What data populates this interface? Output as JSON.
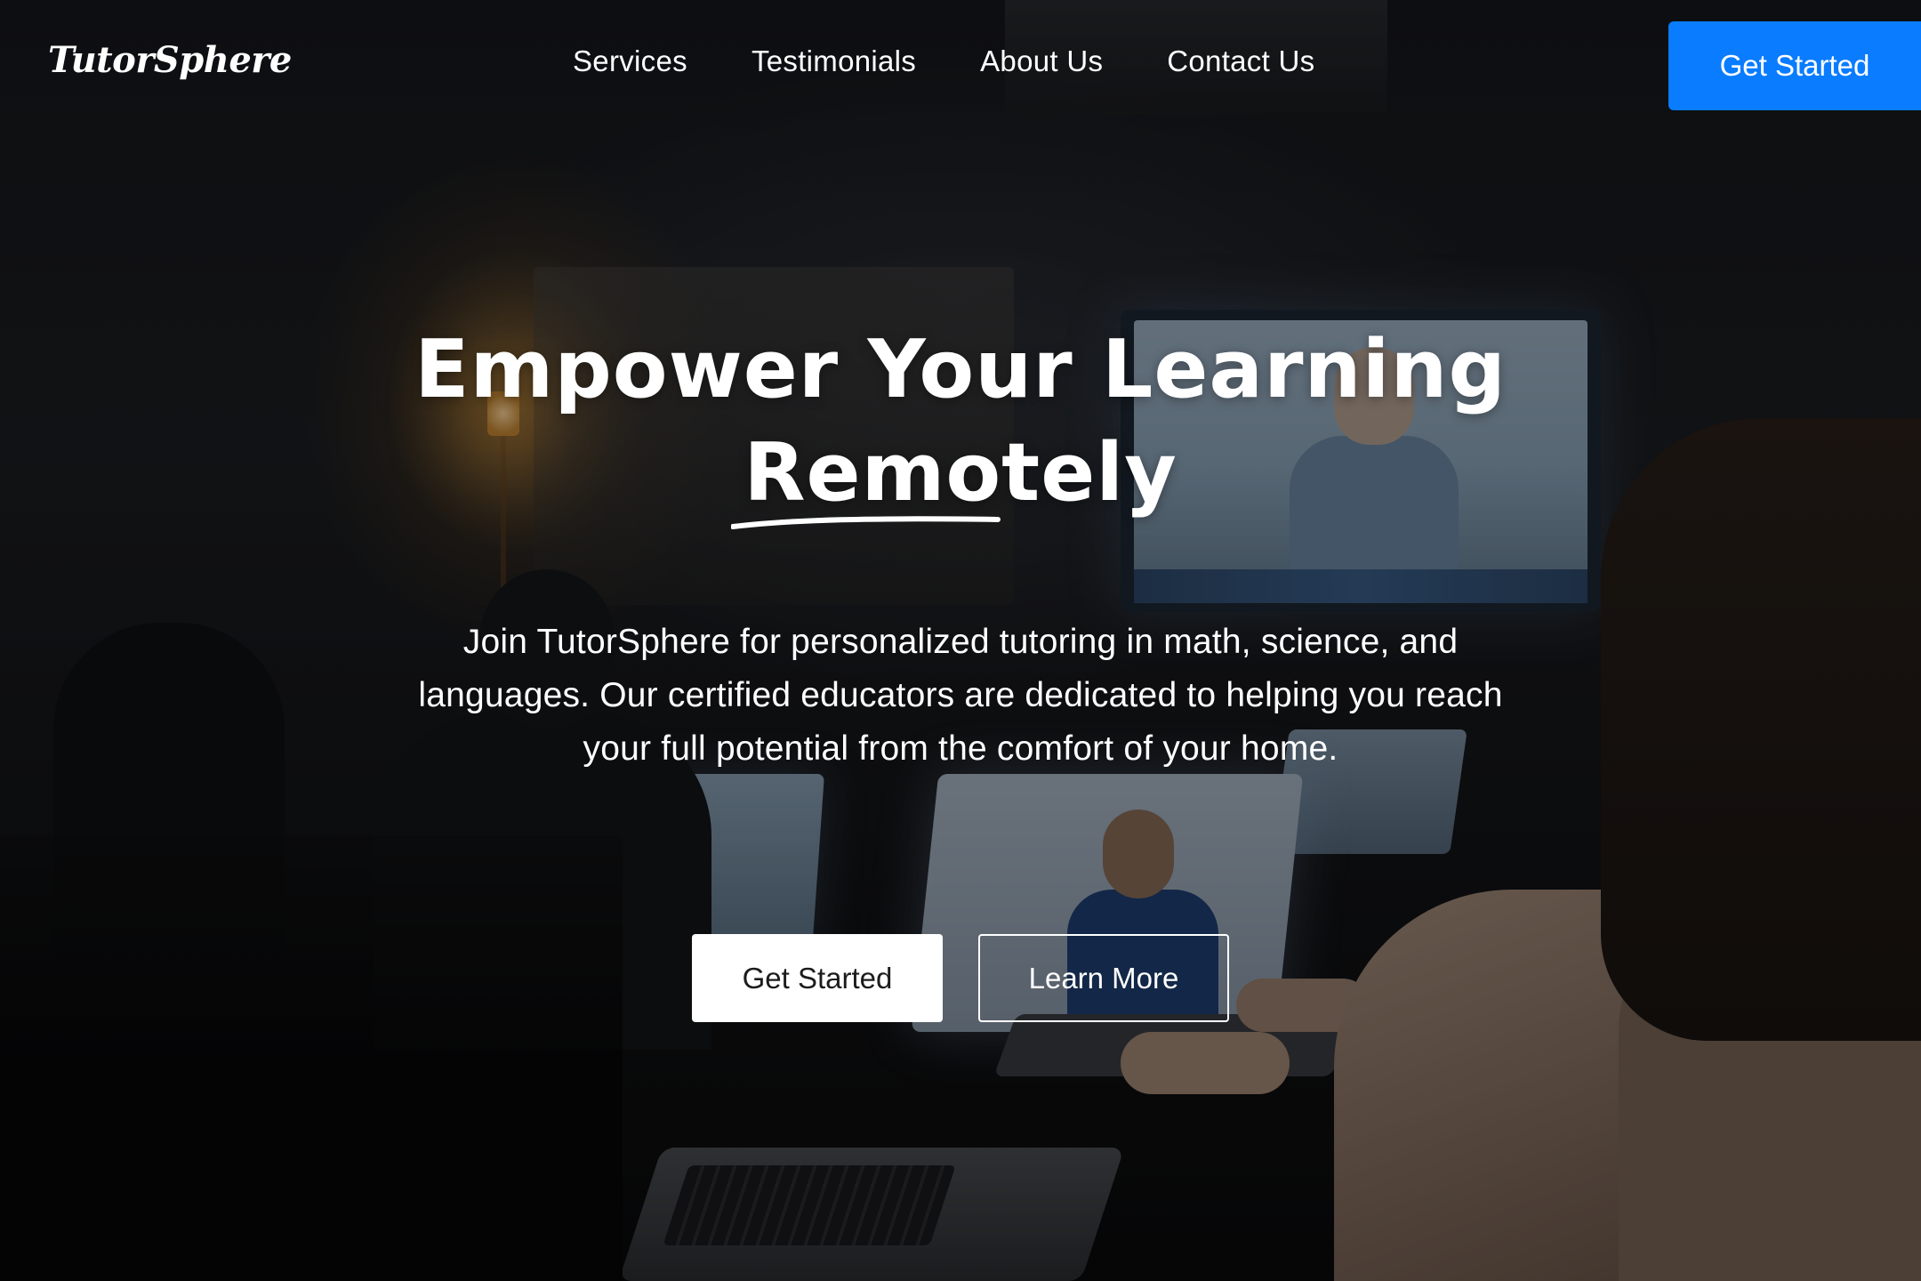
{
  "nav": {
    "logo_text": "TutorSphere",
    "links": [
      {
        "label": "Services"
      },
      {
        "label": "Testimonials"
      },
      {
        "label": "About Us"
      },
      {
        "label": "Contact Us"
      }
    ],
    "cta_label": "Get Started"
  },
  "hero": {
    "title_line1": "Empower Your Learning",
    "title_line2": "Remotely",
    "description": "Join TutorSphere for personalized tutoring in math, science, and languages. Our certified educators are dedicated to helping you reach your full potential from the comfort of your home.",
    "primary_button": "Get Started",
    "secondary_button": "Learn More"
  },
  "colors": {
    "accent": "#0a7cff",
    "text": "#ffffff",
    "primary_button_bg": "#ffffff",
    "primary_button_text": "#1c1c1c"
  }
}
